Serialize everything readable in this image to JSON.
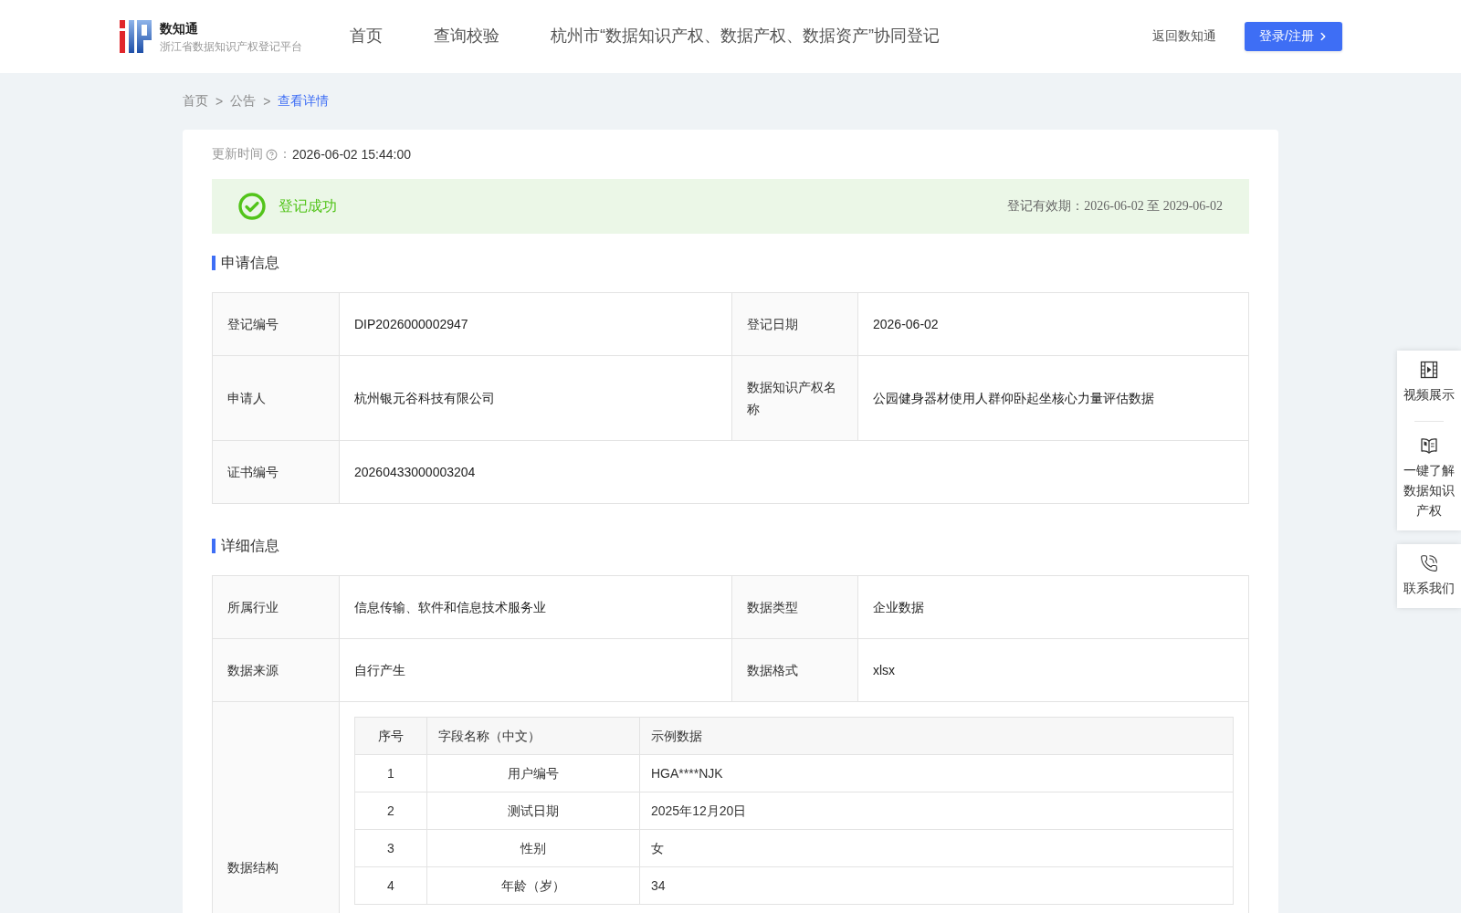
{
  "header": {
    "logo": {
      "title": "数知通",
      "subtitle": "浙江省数据知识产权登记平台"
    },
    "nav": [
      {
        "label": "首页",
        "selected": false
      },
      {
        "label": "查询校验",
        "selected": false
      },
      {
        "label": "杭州市“数据知识产权、数据产权、数据资产”协同登记",
        "selected": false
      }
    ],
    "back_link": "返回数知通",
    "login_button": "登录/注册"
  },
  "breadcrumb": [
    {
      "label": "首页",
      "selected": false
    },
    {
      "separator": ">",
      "label": "公告",
      "selected": false
    },
    {
      "separator": ">",
      "label": "查看详情",
      "selected": true
    }
  ],
  "update": {
    "label": "更新时间",
    "separator": "：",
    "value": "2026-06-02 15:44:00"
  },
  "status": {
    "kind": "success",
    "label": "登记成功",
    "validity": "登记有效期：2026-06-02 至 2029-06-02"
  },
  "sections": [
    {
      "title": "申请信息",
      "rows": [
        {
          "fields": [
            {
              "label": "登记编号",
              "value": "DIP2026000002947"
            },
            {
              "label": "登记日期",
              "value": "2026-06-02"
            }
          ]
        },
        {
          "fields": [
            {
              "label": "申请人",
              "value": "杭州银元谷科技有限公司"
            },
            {
              "label": "数据知识产权名称",
              "value": "公园健身器材使用人群仰卧起坐核心力量评估数据"
            }
          ]
        },
        {
          "fields": [
            {
              "label": "证书编号",
              "value": "20260433000003204"
            }
          ]
        }
      ]
    },
    {
      "title": "详细信息",
      "rows": [
        {
          "fields": [
            {
              "label": "所属行业",
              "value": "信息传输、软件和信息技术服务业"
            },
            {
              "label": "数据类型",
              "value": "企业数据"
            }
          ]
        },
        {
          "fields": [
            {
              "label": "数据来源",
              "value": "自行产生"
            },
            {
              "label": "数据格式",
              "value": "xlsx"
            }
          ]
        },
        {
          "fields": [
            {
              "label": "数据结构",
              "table": {
                "columns": [
                  "序号",
                  "字段名称（中文）",
                  "示例数据"
                ],
                "rows": [
                  [
                    "1",
                    "用户编号",
                    "HGA****NJK"
                  ],
                  [
                    "2",
                    "测试日期",
                    "2025年12月20日"
                  ],
                  [
                    "3",
                    "性别",
                    "女"
                  ],
                  [
                    "4",
                    "年龄（岁）",
                    "34"
                  ]
                ]
              }
            }
          ]
        }
      ]
    }
  ],
  "side_panel": {
    "groups": [
      {
        "items": [
          {
            "kind": "video",
            "label": "视频展示"
          },
          {
            "kind": "guide",
            "label": "一键了解数据知识产权"
          }
        ]
      },
      {
        "items": [
          {
            "kind": "contact",
            "label": "联系我们"
          }
        ]
      }
    ]
  }
}
